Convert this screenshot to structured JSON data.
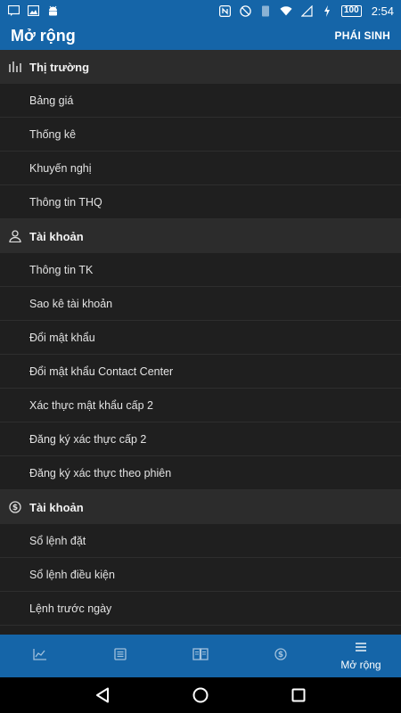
{
  "status_bar": {
    "battery": "100",
    "time": "2:54"
  },
  "header": {
    "title": "Mở rộng",
    "action": "PHÁI SINH"
  },
  "sections": [
    {
      "title": "Thị trường",
      "icon": "bar-chart-icon",
      "items": [
        "Bảng giá",
        "Thống kê",
        "Khuyến nghị",
        "Thông tin THQ"
      ]
    },
    {
      "title": "Tài khoản",
      "icon": "user-icon",
      "items": [
        "Thông tin TK",
        "Sao kê tài khoản",
        "Đổi mật khẩu",
        "Đổi mật khẩu Contact Center",
        "Xác thực mật khẩu cấp 2",
        "Đăng ký xác thực cấp 2",
        "Đăng ký xác thực theo phiên"
      ]
    },
    {
      "title": "Tài khoản",
      "icon": "dollar-cycle-icon",
      "items": [
        "Sổ lệnh đặt",
        "Sổ lệnh điều kiện",
        "Lệnh trước ngày"
      ]
    }
  ],
  "bottom_nav": {
    "active_label": "Mở rộng"
  },
  "colors": {
    "primary": "#1565a8",
    "section_bg": "#2c2c2c",
    "row_bg": "#1f1f1f"
  }
}
